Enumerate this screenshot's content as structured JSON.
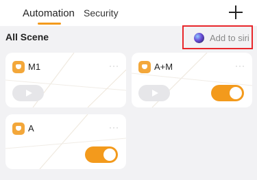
{
  "header": {
    "tabs": [
      {
        "label": "Automation",
        "active": true
      },
      {
        "label": "Security",
        "active": false
      }
    ],
    "add_icon": "plus-icon"
  },
  "section": {
    "title": "All Scene",
    "siri_label": "Add to siri",
    "siri_icon": "siri-icon"
  },
  "scenes": [
    {
      "name": "M1",
      "more": "···",
      "run_icon": "play-icon",
      "enabled_toggle": null
    },
    {
      "name": "A+M",
      "more": "···",
      "run_icon": "play-icon",
      "enabled_toggle": true
    },
    {
      "name": "A",
      "more": "···",
      "run_icon": null,
      "enabled_toggle": true
    }
  ],
  "colors": {
    "accent": "#f39a1c",
    "highlight_border": "#e8262a",
    "background": "#f2f2f4"
  }
}
